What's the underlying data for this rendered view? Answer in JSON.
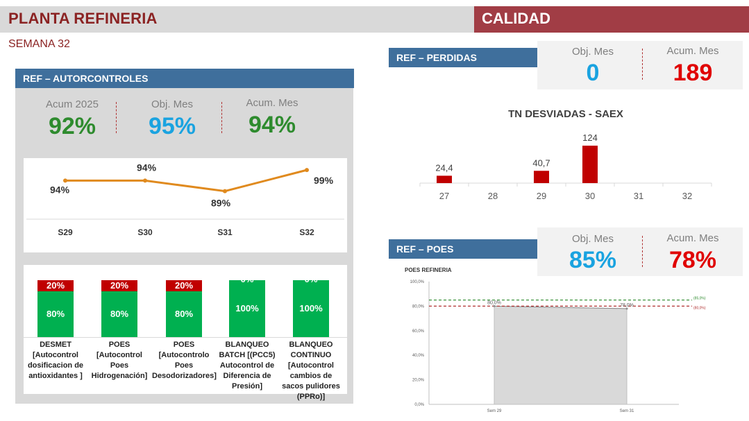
{
  "header": {
    "title": "PLANTA REFINERIA",
    "section": "CALIDAD",
    "week": "SEMANA 32"
  },
  "colors": {
    "accent": "#a13d45",
    "header_blue": "#3f6f9c",
    "green": "#2e8b2e",
    "blue": "#1aa3e0",
    "red": "#e00000",
    "line": "#e08a1e"
  },
  "autocontroles": {
    "title": "REF – AUTORCONTROLES",
    "kpis": [
      {
        "label": "Acum 2025",
        "value": "92%"
      },
      {
        "label": "Obj. Mes",
        "value": "95%"
      },
      {
        "label": "Acum. Mes",
        "value": "94%"
      }
    ],
    "stacks": [
      {
        "name": "DESMET [Autocontrol dosificacion de antioxidantes ]",
        "red": "20%",
        "green": "80%",
        "red_frac": 0.2
      },
      {
        "name": "POES [Autocontrol Poes Hidrogenación]",
        "red": "20%",
        "green": "80%",
        "red_frac": 0.2
      },
      {
        "name": "POES [Autocontrolo Poes Desodorizadores]",
        "red": "20%",
        "green": "80%",
        "red_frac": 0.2
      },
      {
        "name": "BLANQUEO BATCH [(PCC5) Autocontrol de Diferencia de Presión]",
        "red": "0%",
        "green": "100%",
        "red_frac": 0
      },
      {
        "name": "BLANQUEO CONTINUO [Autocontrol cambios de sacos pulidores (PPRo)]",
        "red": "0%",
        "green": "100%",
        "red_frac": 0
      }
    ]
  },
  "perdidas": {
    "title": "REF – PERDIDAS",
    "kpis": [
      {
        "label": "Obj. Mes",
        "value": "0"
      },
      {
        "label": "Acum. Mes",
        "value": "189"
      }
    ]
  },
  "poes": {
    "title": "REF – POES",
    "kpis": [
      {
        "label": "Obj. Mes",
        "value": "85%"
      },
      {
        "label": "Acum. Mes",
        "value": "78%"
      }
    ]
  },
  "chart_data": [
    {
      "type": "line",
      "categories": [
        "S29",
        "S30",
        "S31",
        "S32"
      ],
      "values": [
        94,
        94,
        89,
        99
      ],
      "labels": [
        "94%",
        "94%",
        "89%",
        "99%"
      ],
      "ylim": [
        80,
        102
      ]
    },
    {
      "type": "bar",
      "title": "TN DESVIADAS - SAEX",
      "categories": [
        "27",
        "28",
        "29",
        "30",
        "31",
        "32"
      ],
      "values": [
        24.4,
        null,
        40.7,
        124,
        null,
        null
      ],
      "labels": [
        "24,4",
        "",
        "40,7",
        "124",
        "",
        ""
      ],
      "ylim": [
        0,
        124
      ]
    },
    {
      "type": "area",
      "title": "POES REFINERIA",
      "categories": [
        "Sem 29",
        "Sem 31"
      ],
      "values": [
        80,
        78
      ],
      "labels": [
        "80,0%",
        "78,0%"
      ],
      "yticks": [
        "0,0%",
        "20,0%",
        "40,0%",
        "60,0%",
        "80,0%",
        "100,0%"
      ],
      "ylim": [
        0,
        100
      ],
      "ref_lines": [
        {
          "label": "(85,0%)",
          "value": 85,
          "color": "#2e8b2e"
        },
        {
          "label": "(80,0%)",
          "value": 80,
          "color": "#b03030"
        }
      ]
    }
  ]
}
